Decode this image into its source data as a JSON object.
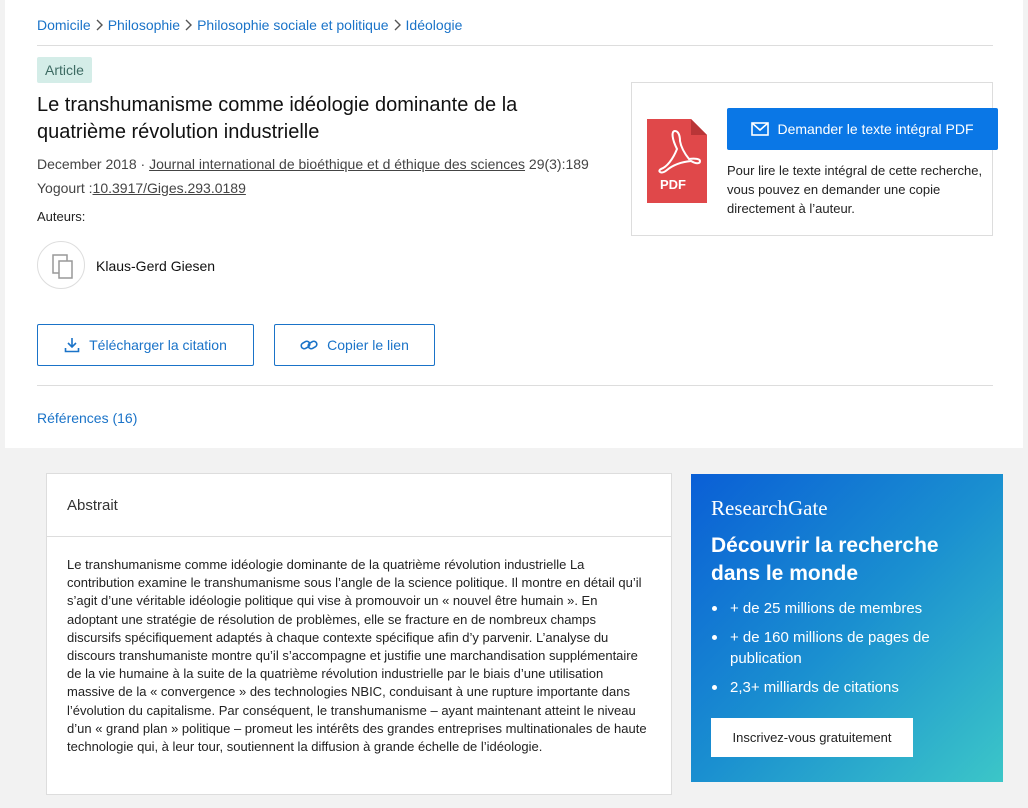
{
  "breadcrumb": {
    "items": [
      "Domicile",
      "Philosophie",
      "Philosophie sociale et politique",
      "Idéologie"
    ],
    "separator_icon": "chevron-right-icon"
  },
  "badge": "Article",
  "title": "Le transhumanisme comme idéologie dominante de la quatrième révolution industrielle",
  "meta": {
    "date": "December 2018",
    "separator": " · ",
    "journal": "Journal international de bioéthique et d éthique des sciences",
    "volume": " 29(3):189",
    "doi_label": "Yogourt :",
    "doi": "10.3917/Giges.293.0189"
  },
  "authors": {
    "label": "Auteurs:",
    "list": [
      {
        "name": "Klaus-Gerd Giesen",
        "avatar_icon": "author-placeholder-icon"
      }
    ]
  },
  "actions": {
    "cite_label": "Télécharger la citation",
    "cite_icon": "download-icon",
    "link_label": "Copier le lien",
    "link_icon": "link-icon"
  },
  "references_label": "Références (16)",
  "pdf_card": {
    "icon": "pdf-icon",
    "icon_text": "PDF",
    "button_label": "Demander le texte intégral PDF",
    "button_icon": "mail-icon",
    "description": "Pour lire le texte intégral de cette recherche, vous pouvez en demander une copie directement à l’auteur."
  },
  "abstract": {
    "heading": "Abstrait",
    "text": "Le transhumanisme comme idéologie dominante de la quatrième révolution industrielle La contribution examine le transhumanisme sous l’angle de la science politique. Il montre en détail qu’il s’agit d’une véritable idéologie politique qui vise à promouvoir un « nouvel être humain ». En adoptant une stratégie de résolution de problèmes, elle se fracture en de nombreux champs discursifs spécifiquement adaptés à chaque contexte spécifique afin d’y parvenir. L’analyse du discours transhumaniste montre qu’il s’accompagne et justifie une marchandisation supplémentaire de la vie humaine à la suite de la quatrième révolution industrielle par le biais d’une utilisation massive de la « convergence » des technologies NBIC, conduisant à une rupture importante dans l’évolution du capitalisme. Par conséquent, le transhumanisme – ayant maintenant atteint le niveau d’un « grand plan » politique – promeut les intérêts des grandes entreprises multinationales de haute technologie qui, à leur tour, soutiennent la diffusion à grande échelle de l’idéologie."
  },
  "promo": {
    "logo": "ResearchGate",
    "headline": "Découvrir la recherche dans le monde",
    "bullets": [
      "+ de 25 millions de membres",
      "+ de 160 millions de pages de publication",
      "2,3+ milliards de citations"
    ],
    "button_label": "Inscrivez-vous gratuitement"
  },
  "colors": {
    "link": "#1a73c8",
    "primary_button": "#0a77e6",
    "badge_bg": "#d4ede8",
    "pdf_red": "#e0484a"
  }
}
